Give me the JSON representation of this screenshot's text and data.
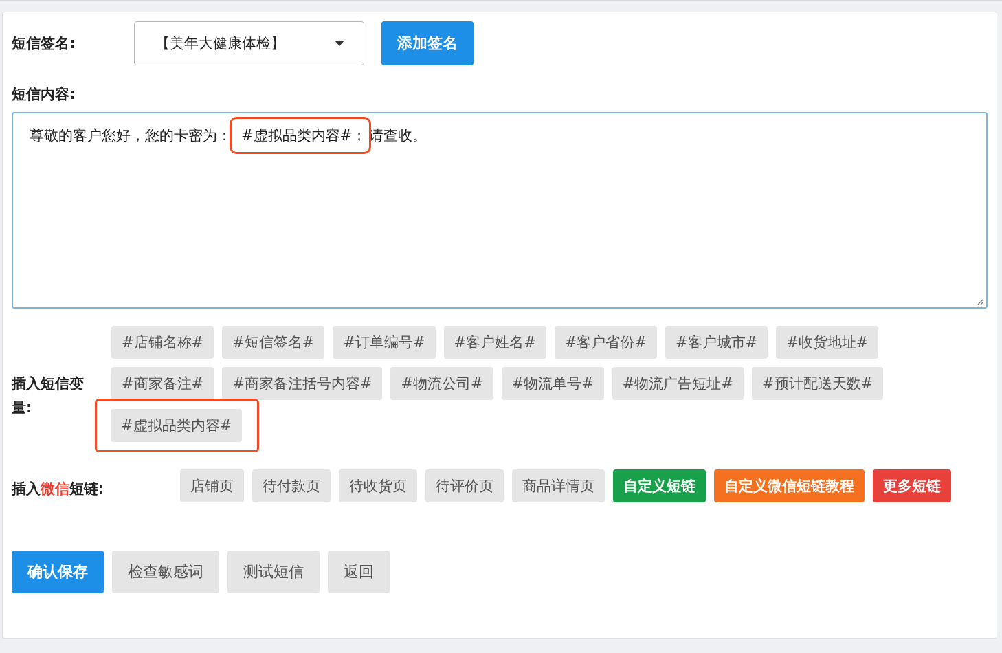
{
  "signature": {
    "label": "短信签名:",
    "value": "【美年大健康体检】",
    "add_button": "添加签名"
  },
  "content": {
    "label": "短信内容:",
    "parts": [
      {
        "text": "尊敬的客户您好，您的卡密为：",
        "annotated": false
      },
      {
        "text": "#虚拟品类内容#；",
        "annotated": true
      },
      {
        "text": "请查收。",
        "annotated": false
      }
    ]
  },
  "variables": {
    "label": "插入短信变量:",
    "items": [
      {
        "text": "#店铺名称#",
        "annotated": false
      },
      {
        "text": "#短信签名#",
        "annotated": false
      },
      {
        "text": "#订单编号#",
        "annotated": false
      },
      {
        "text": "#客户姓名#",
        "annotated": false
      },
      {
        "text": "#客户省份#",
        "annotated": false
      },
      {
        "text": "#客户城市#",
        "annotated": false
      },
      {
        "text": "#收货地址#",
        "annotated": false
      },
      {
        "text": "#商家备注#",
        "annotated": false
      },
      {
        "text": "#商家备注括号内容#",
        "annotated": false
      },
      {
        "text": "#物流公司#",
        "annotated": false
      },
      {
        "text": "#物流单号#",
        "annotated": false
      },
      {
        "text": "#物流广告短址#",
        "annotated": false
      },
      {
        "text": "#预计配送天数#",
        "annotated": false
      },
      {
        "text": "#虚拟品类内容#",
        "annotated": true
      }
    ]
  },
  "shortlinks": {
    "label_before": "插入",
    "label_highlight": "微信",
    "label_after": "短链:",
    "items": [
      {
        "text": "店铺页",
        "kind": "plain"
      },
      {
        "text": "待付款页",
        "kind": "plain"
      },
      {
        "text": "待收货页",
        "kind": "plain"
      },
      {
        "text": "待评价页",
        "kind": "plain"
      },
      {
        "text": "商品详情页",
        "kind": "plain"
      },
      {
        "text": "自定义短链",
        "kind": "success"
      },
      {
        "text": "自定义微信短链教程",
        "kind": "warning"
      },
      {
        "text": "更多短链",
        "kind": "danger"
      }
    ]
  },
  "actions": [
    {
      "text": "确认保存",
      "kind": "primary"
    },
    {
      "text": "检查敏感词",
      "kind": "plain"
    },
    {
      "text": "测试短信",
      "kind": "plain"
    },
    {
      "text": "返回",
      "kind": "plain"
    }
  ]
}
